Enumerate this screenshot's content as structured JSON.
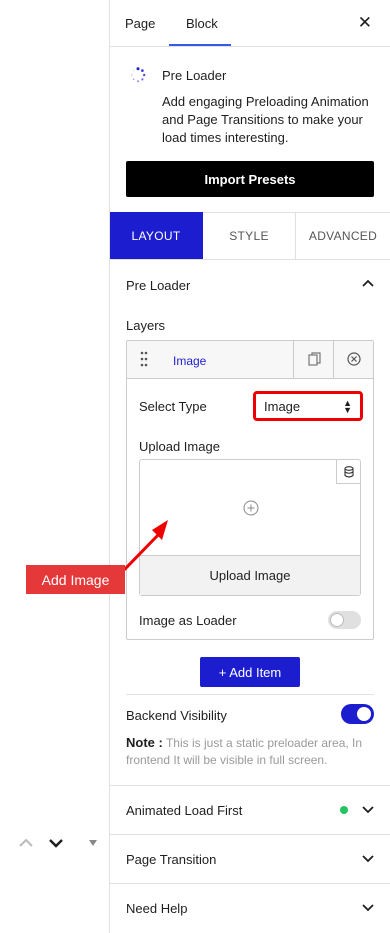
{
  "sidebar_tabs": {
    "page": "Page",
    "block": "Block"
  },
  "block": {
    "title": "Pre Loader",
    "description": "Add engaging Preloading Animation and Page Transitions to make your load times interesting.",
    "import_button": "Import Presets"
  },
  "settings_tabs": {
    "layout": "LAYOUT",
    "style": "STYLE",
    "advanced": "ADVANCED"
  },
  "preloader_section": {
    "title": "Pre Loader",
    "layers_label": "Layers",
    "layer": {
      "name": "Image",
      "select_type_label": "Select Type",
      "select_type_value": "Image",
      "upload_label": "Upload Image",
      "upload_button": "Upload Image",
      "image_as_loader_label": "Image as Loader",
      "image_as_loader_enabled": false
    },
    "add_item": "+ Add Item",
    "backend_visibility_label": "Backend Visibility",
    "backend_visibility_enabled": true,
    "note_label": "Note :",
    "note_text": "This is just a static preloader area, In frontend It will be visible in full screen."
  },
  "collapsed_sections": {
    "animated": "Animated Load First",
    "transition": "Page Transition",
    "help": "Need Help"
  },
  "annotation": {
    "callout": "Add Image"
  },
  "colors": {
    "accent": "#1d1dd0",
    "highlight": "#e00000",
    "callout": "#e53939",
    "status": "#22c55e"
  }
}
